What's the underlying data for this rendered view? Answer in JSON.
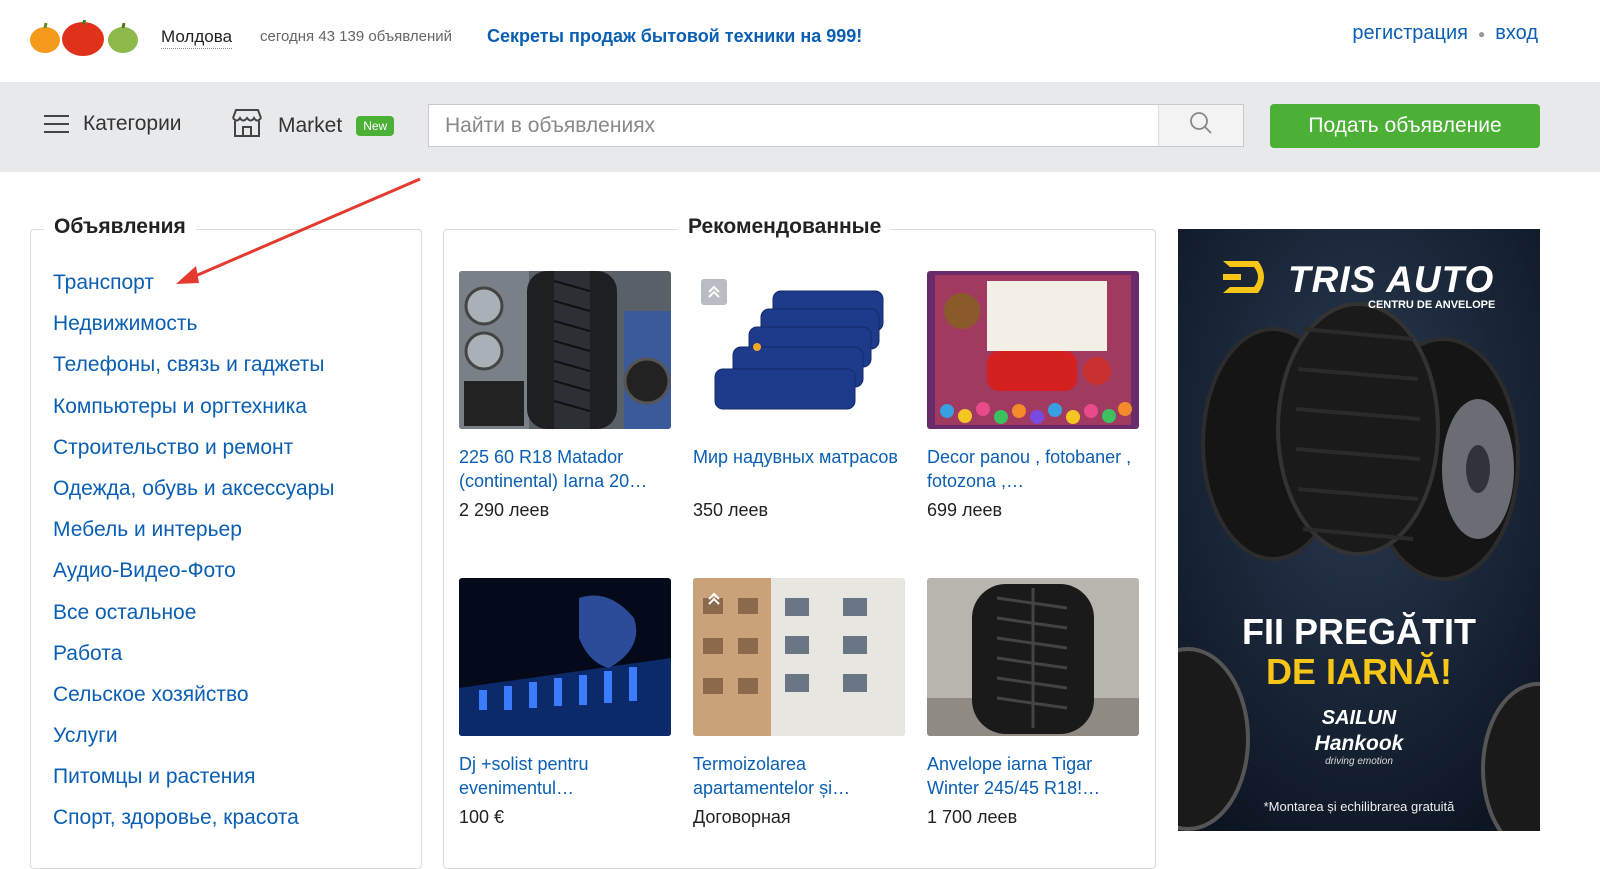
{
  "header": {
    "region": "Молдова",
    "stats": "сегодня 43 139 объявлений",
    "promo": "Секреты продаж бытовой техники на 999!",
    "register": "регистрация",
    "login": "вход"
  },
  "toolbar": {
    "categories_label": "Категории",
    "market_label": "Market",
    "market_badge": "New",
    "search_placeholder": "Найти в объявлениях",
    "post_button": "Подать объявление"
  },
  "sidebar": {
    "title": "Объявления",
    "items": [
      "Транспорт",
      "Недвижимость",
      "Телефоны, связь и гаджеты",
      "Компьютеры и оргтехника",
      "Строительство и ремонт",
      "Одежда, обувь и аксессуары",
      "Мебель и интерьер",
      "Аудио-Видео-Фото",
      "Все остальное",
      "Работа",
      "Сельское хозяйство",
      "Услуги",
      "Питомцы и растения",
      "Спорт, здоровье, красота"
    ]
  },
  "recommended": {
    "title": "Рекомендованные",
    "items": [
      {
        "title": "225 60 R18 Matador (continental) Iarna 20…",
        "price": "2 290 леев",
        "image": "tire-shop-photo"
      },
      {
        "title": "Мир надувных матрасов",
        "price": "350 леев",
        "image": "inflatable-mattress-photo"
      },
      {
        "title": "Decor panou , fotobaner , fotozona ,…",
        "price": "699 леев",
        "image": "photo-zone-decor-photo"
      },
      {
        "title": "Dj +solist pentru evenimentul…",
        "price": "100 €",
        "image": "dj-mixer-photo"
      },
      {
        "title": "Termoizolarea apartamentelor și…",
        "price": "Договорная",
        "image": "apartment-building-photo"
      },
      {
        "title": "Anvelope iarna Tigar Winter 245/45 R18!…",
        "price": "1 700 леев",
        "image": "winter-tire-photo"
      }
    ]
  },
  "banner": {
    "brand": "TRIS AUTO",
    "subtitle": "CENTRU DE ANVELOPE",
    "headline_1": "FII PREGĂTIT",
    "headline_2": "DE IARNĂ!",
    "brand_2": "SAILUN",
    "brand_3": "Hankook",
    "brand_3_tagline": "driving emotion",
    "footer": "*Montarea și echilibrarea gratuită"
  },
  "annotation": {
    "arrow_color": "#e53a2f"
  }
}
